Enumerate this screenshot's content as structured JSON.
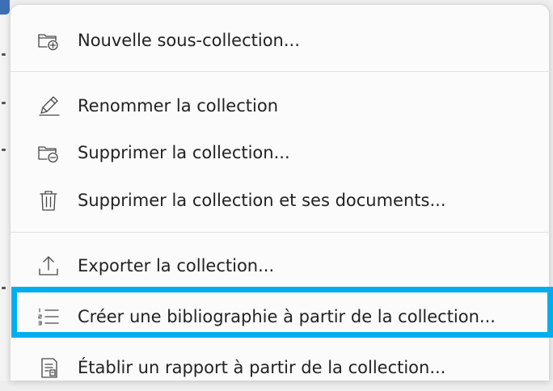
{
  "menu": {
    "items": [
      {
        "id": "new-subcollection",
        "label": "Nouvelle sous-collection...",
        "icon": "folder-add-icon"
      },
      {
        "id": "rename-collection",
        "label": "Renommer la collection",
        "icon": "pencil-icon"
      },
      {
        "id": "delete-collection",
        "label": "Supprimer la collection...",
        "icon": "folder-remove-icon"
      },
      {
        "id": "delete-collection-and-items",
        "label": "Supprimer la collection et ses documents...",
        "icon": "trash-icon"
      },
      {
        "id": "export-collection",
        "label": "Exporter la collection...",
        "icon": "export-icon"
      },
      {
        "id": "create-bibliography",
        "label": "Créer une bibliographie à partir de la collection...",
        "icon": "numbered-list-icon",
        "highlighted": true
      },
      {
        "id": "generate-report",
        "label": "Établir un rapport à partir de la collection...",
        "icon": "report-icon"
      }
    ]
  },
  "colors": {
    "highlight": "#00aeef",
    "menu_background": "#fbfbfb",
    "text": "#222222",
    "icon": "#4a4a4a"
  }
}
